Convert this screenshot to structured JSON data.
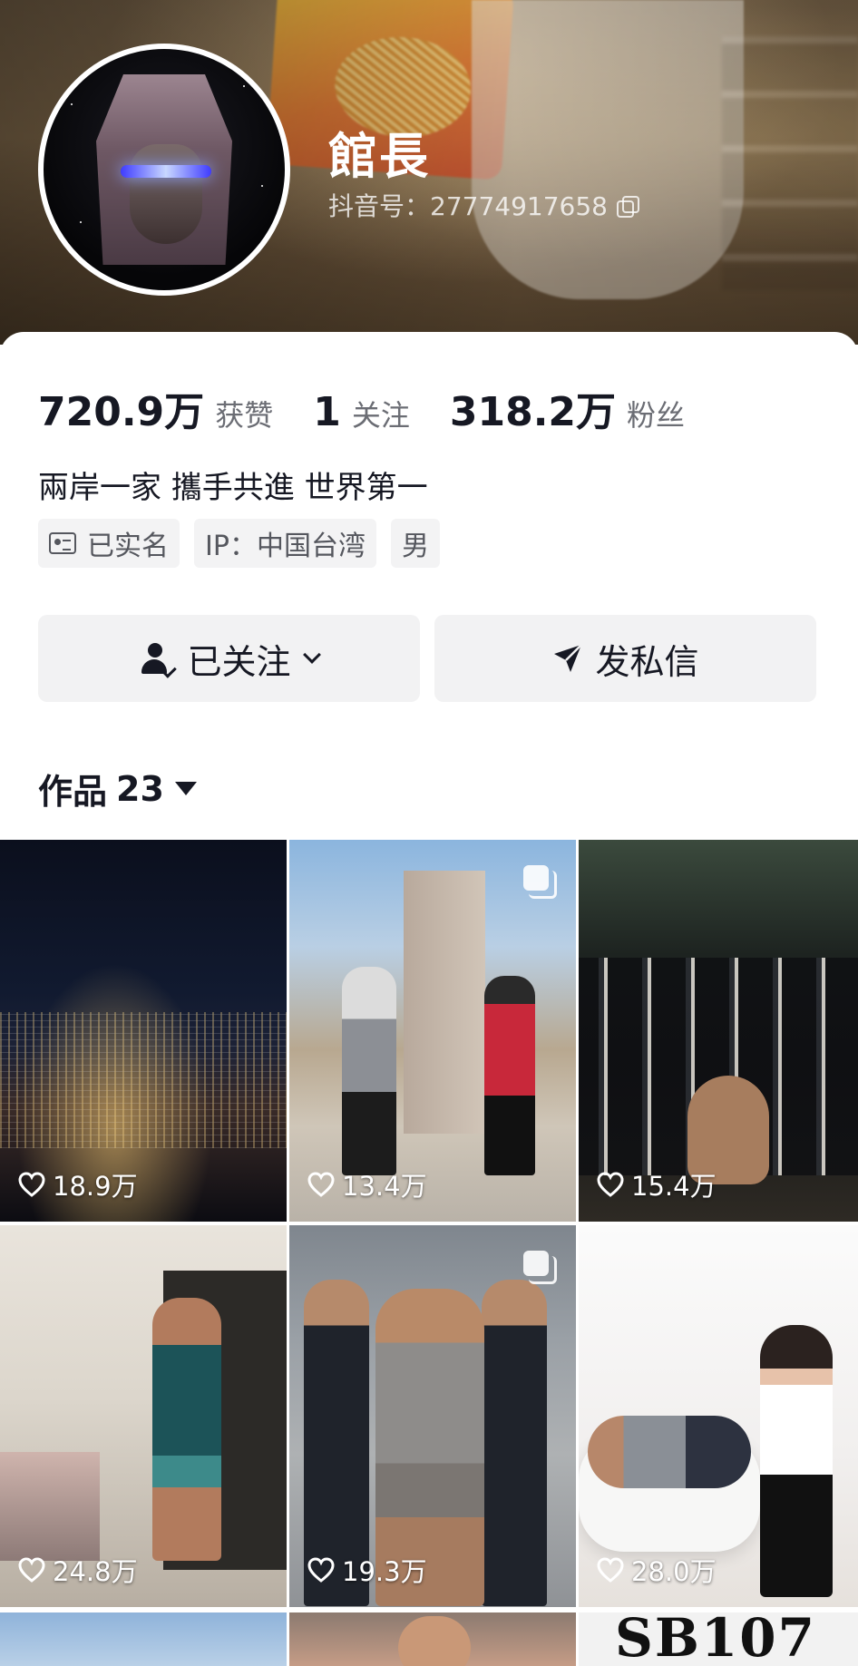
{
  "profile": {
    "name": "館長",
    "douyin_id": "抖音号：27774917658"
  },
  "stats": {
    "likes_value": "720.9万",
    "likes_label": "获赞",
    "following_value": "1",
    "following_label": "关注",
    "followers_value": "318.2万",
    "followers_label": "粉丝"
  },
  "bio": "兩岸一家 攜手共進 世界第一",
  "tags": {
    "verified": "已实名",
    "ip": "IP：中国台湾",
    "gender": "男"
  },
  "actions": {
    "follow_label": "已关注",
    "message_label": "发私信"
  },
  "works": {
    "label": "作品",
    "count": "23"
  },
  "videos": [
    {
      "likes": "18.9万",
      "multi": false
    },
    {
      "likes": "13.4万",
      "multi": true
    },
    {
      "likes": "15.4万",
      "multi": false
    },
    {
      "likes": "24.8万",
      "multi": false
    },
    {
      "likes": "19.3万",
      "multi": true
    },
    {
      "likes": "28.0万",
      "multi": false
    }
  ],
  "partial_row": {
    "logo_text": "SB107"
  },
  "colors": {
    "text": "#161823",
    "muted": "#6b6d74",
    "button_bg": "#f2f2f3"
  }
}
